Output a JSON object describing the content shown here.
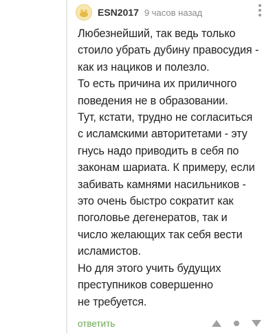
{
  "comment": {
    "author": "ESN2017",
    "time": "9 часов назад",
    "body_lines": [
      "Любезнейший, так ведь только",
      "стоило убрать дубину правосудия -",
      "как из нациков и полезло.",
      "То есть причина их приличного",
      "поведения не в образовании.",
      "Тут, кстати, трудно не согласиться",
      "с исламскими авторитетами - эту",
      "гнусь надо приводить в себя по",
      "законам шариата. К примеру, если",
      "забивать камнями насильников -",
      "это очень быстро сократит как",
      "поголовье дегенератов, так и",
      "число желающих так себя вести",
      "исламистов.",
      "Но для этого учить будущих",
      "преступников совершенно",
      "не требуется."
    ],
    "reply_label": "ответить"
  },
  "icons": {
    "avatar": "avatar-image",
    "more": "more-vertical-icon",
    "vote_up": "vote-up-icon",
    "vote_down": "vote-down-icon"
  },
  "colors": {
    "reply": "#6aa84f",
    "icon_gray": "#a0a0a0",
    "author": "#333333",
    "time": "#8a8a8a",
    "text": "#222222"
  }
}
